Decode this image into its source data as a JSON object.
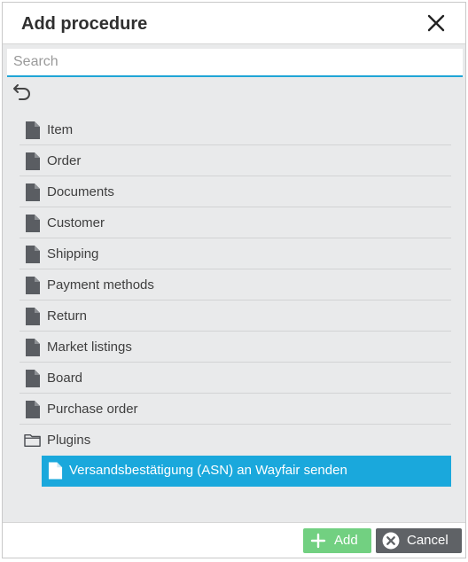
{
  "dialog": {
    "title": "Add procedure"
  },
  "search": {
    "placeholder": "Search",
    "value": ""
  },
  "tree": {
    "items": [
      {
        "label": "Item",
        "icon": "document-icon"
      },
      {
        "label": "Order",
        "icon": "document-icon"
      },
      {
        "label": "Documents",
        "icon": "document-icon"
      },
      {
        "label": "Customer",
        "icon": "document-icon"
      },
      {
        "label": "Shipping",
        "icon": "document-icon"
      },
      {
        "label": "Payment methods",
        "icon": "document-icon"
      },
      {
        "label": "Return",
        "icon": "document-icon"
      },
      {
        "label": "Market listings",
        "icon": "document-icon"
      },
      {
        "label": "Board",
        "icon": "document-icon"
      },
      {
        "label": "Purchase order",
        "icon": "document-icon"
      },
      {
        "label": "Plugins",
        "icon": "folder-open-icon"
      }
    ],
    "selected_child": {
      "label": "Versandsbestätigung (ASN) an Wayfair senden",
      "icon": "document-icon"
    }
  },
  "footer": {
    "add_label": "Add",
    "cancel_label": "Cancel"
  },
  "colors": {
    "accent": "#1aa8dc",
    "add_button": "#72d081",
    "cancel_button": "#5f6266",
    "panel_bg": "#e9eaeb"
  }
}
